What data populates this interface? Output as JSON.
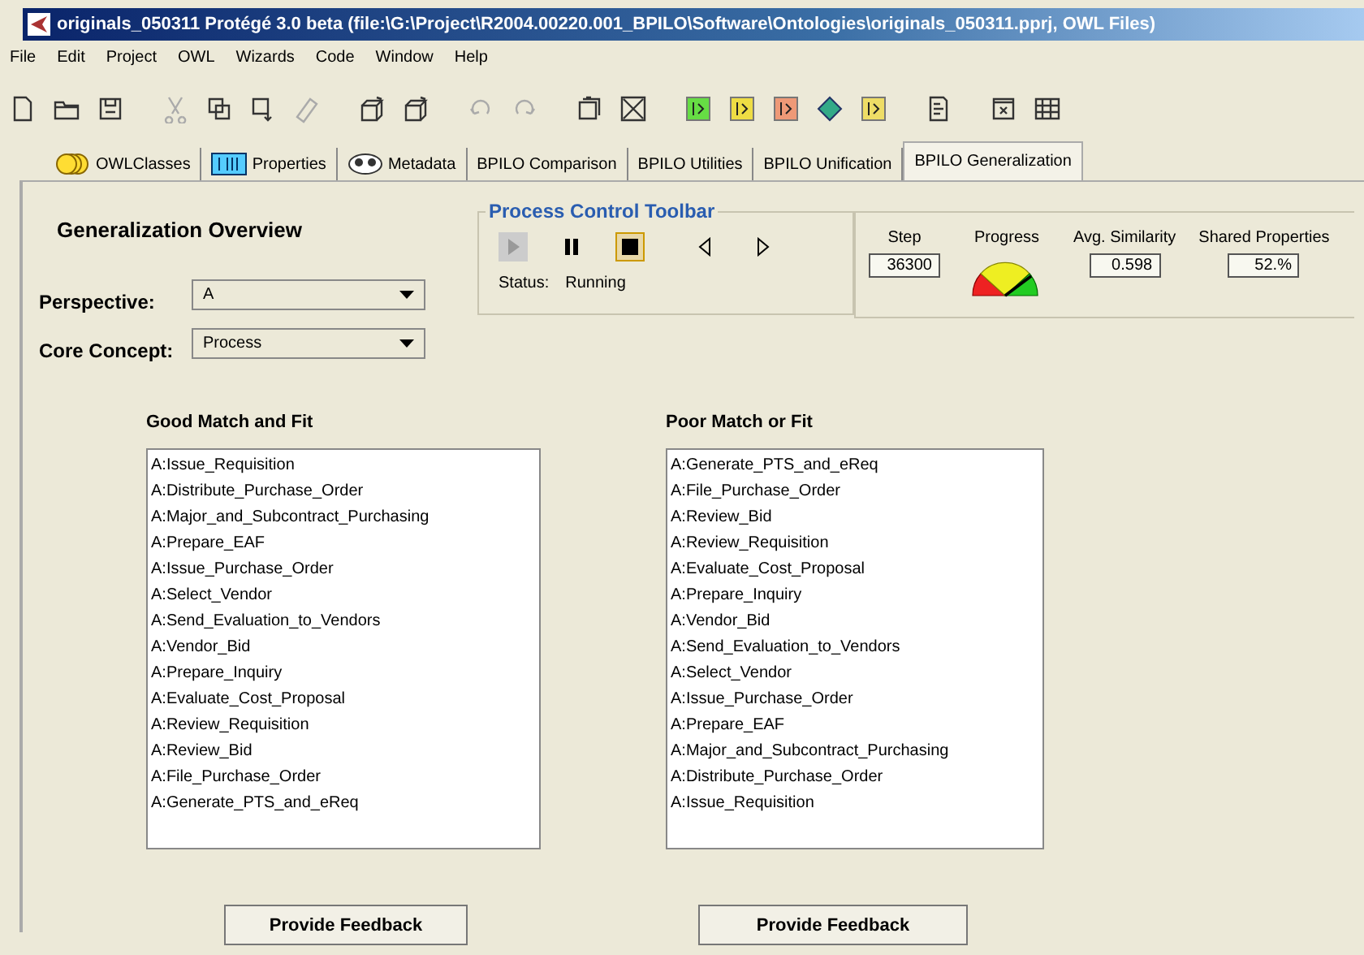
{
  "window": {
    "title": "originals_050311  Protégé 3.0 beta   (file:\\G:\\Project\\R2004.00220.001_BPILO\\Software\\Ontologies\\originals_050311.pprj, OWL Files)"
  },
  "menu": [
    "File",
    "Edit",
    "Project",
    "OWL",
    "Wizards",
    "Code",
    "Window",
    "Help"
  ],
  "toolbar": [
    {
      "kind": "new",
      "disabled": false
    },
    {
      "kind": "open",
      "disabled": false
    },
    {
      "kind": "save",
      "disabled": false
    },
    {
      "kind": "gap"
    },
    {
      "kind": "cut",
      "disabled": true
    },
    {
      "kind": "copy",
      "disabled": false
    },
    {
      "kind": "paste",
      "disabled": false
    },
    {
      "kind": "erase",
      "disabled": true
    },
    {
      "kind": "gap"
    },
    {
      "kind": "cube",
      "disabled": false
    },
    {
      "kind": "cube",
      "disabled": false
    },
    {
      "kind": "gap"
    },
    {
      "kind": "undo",
      "disabled": true
    },
    {
      "kind": "redo",
      "disabled": true
    },
    {
      "kind": "gap"
    },
    {
      "kind": "stack",
      "disabled": false
    },
    {
      "kind": "delete",
      "disabled": false
    },
    {
      "kind": "gap"
    },
    {
      "kind": "tag",
      "color": "#66dd44"
    },
    {
      "kind": "tag",
      "color": "#eedd44"
    },
    {
      "kind": "tag",
      "color": "#ee9977"
    },
    {
      "kind": "diamond"
    },
    {
      "kind": "tag",
      "color": "#eedd66"
    },
    {
      "kind": "gap"
    },
    {
      "kind": "doc",
      "disabled": false
    },
    {
      "kind": "gap"
    },
    {
      "kind": "window",
      "disabled": false
    },
    {
      "kind": "grid",
      "disabled": false
    }
  ],
  "tabs": [
    {
      "label": "OWLClasses",
      "kind": "classes",
      "selected": false
    },
    {
      "label": "Properties",
      "kind": "properties",
      "selected": false
    },
    {
      "label": "Metadata",
      "kind": "metadata",
      "selected": false
    },
    {
      "label": "BPILO Comparison",
      "selected": false
    },
    {
      "label": "BPILO Utilities",
      "selected": false
    },
    {
      "label": "BPILO Unification",
      "selected": false
    },
    {
      "label": "BPILO Generalization",
      "selected": true
    }
  ],
  "overview": {
    "title": "Generalization Overview",
    "fields": [
      {
        "label": "Perspective:",
        "value": "A"
      },
      {
        "label": "Core Concept:",
        "value": "Process"
      }
    ]
  },
  "process_toolbar": {
    "title": "Process Control Toolbar",
    "buttons": [
      {
        "kind": "play",
        "disabled": true,
        "selected": false
      },
      {
        "kind": "pause",
        "disabled": false,
        "selected": false
      },
      {
        "kind": "stop",
        "disabled": false,
        "selected": true
      },
      {
        "kind": "back",
        "disabled": false,
        "selected": false
      },
      {
        "kind": "forward",
        "disabled": false,
        "selected": false
      }
    ],
    "status_label": "Status:",
    "status": "Running"
  },
  "stats": {
    "step_label": "Step",
    "step": "36300",
    "progress_label": "Progress",
    "similarity_label": "Avg. Similarity",
    "similarity": "0.598",
    "shared_label": "Shared Properties",
    "shared": "52.%"
  },
  "lists": [
    {
      "title": "Good Match and Fit",
      "items": [
        "A:Issue_Requisition",
        "A:Distribute_Purchase_Order",
        "A:Major_and_Subcontract_Purchasing",
        "A:Prepare_EAF",
        "A:Issue_Purchase_Order",
        "A:Select_Vendor",
        "A:Send_Evaluation_to_Vendors",
        "A:Vendor_Bid",
        "A:Prepare_Inquiry",
        "A:Evaluate_Cost_Proposal",
        "A:Review_Requisition",
        "A:Review_Bid",
        "A:File_Purchase_Order",
        "A:Generate_PTS_and_eReq"
      ],
      "button": "Provide Feedback"
    },
    {
      "title": "Poor Match or Fit",
      "items": [
        "A:Generate_PTS_and_eReq",
        "A:File_Purchase_Order",
        "A:Review_Bid",
        "A:Review_Requisition",
        "A:Evaluate_Cost_Proposal",
        "A:Prepare_Inquiry",
        "A:Vendor_Bid",
        "A:Send_Evaluation_to_Vendors",
        "A:Select_Vendor",
        "A:Issue_Purchase_Order",
        "A:Prepare_EAF",
        "A:Major_and_Subcontract_Purchasing",
        "A:Distribute_Purchase_Order",
        "A:Issue_Requisition"
      ],
      "button": "Provide Feedback"
    }
  ]
}
